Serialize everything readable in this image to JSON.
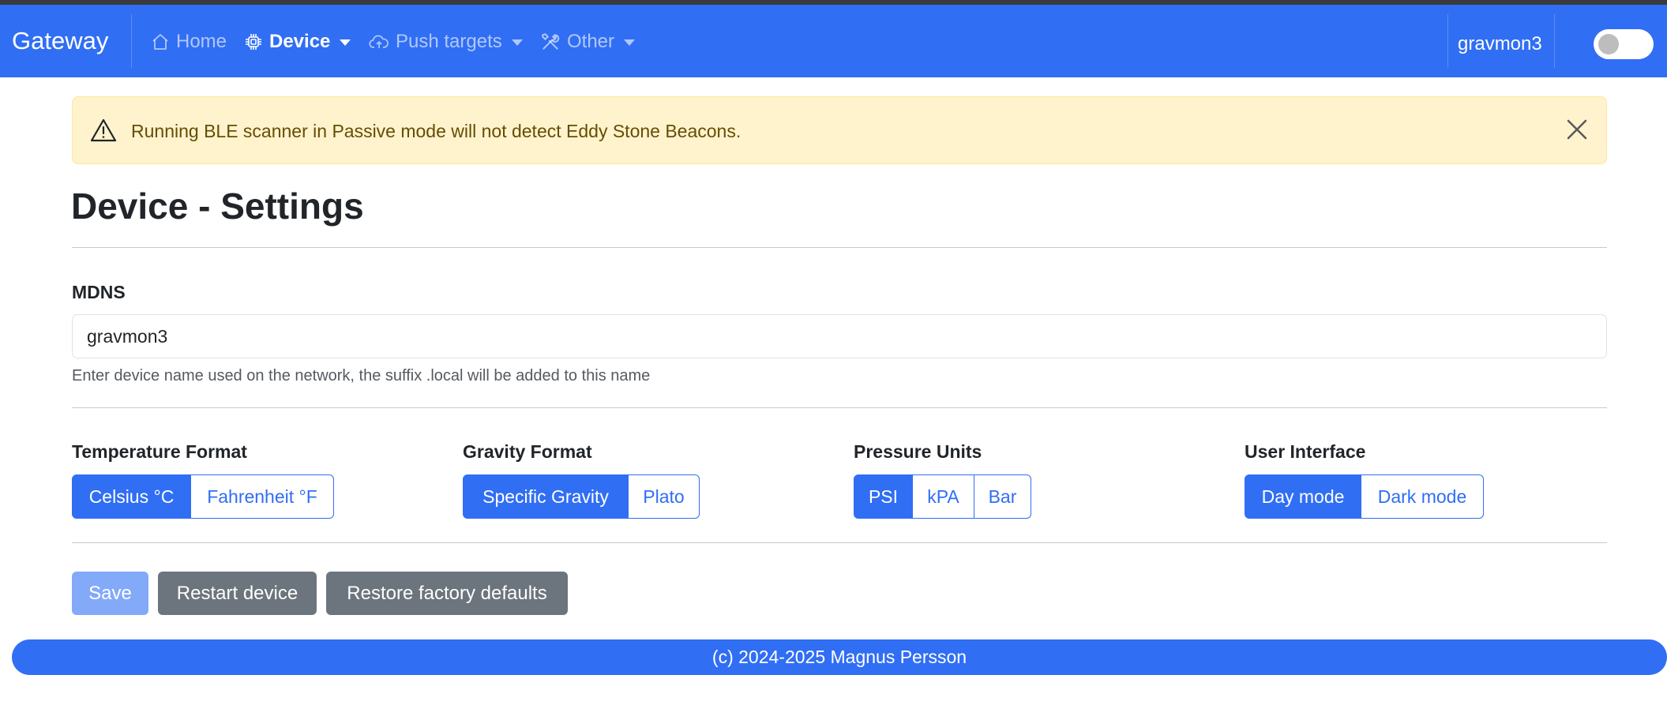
{
  "colors": {
    "primary": "#306ef4",
    "warning_bg": "#fff3cd",
    "warning_text": "#664d03",
    "secondary": "#6c757d"
  },
  "navbar": {
    "brand": "Gateway",
    "items": [
      {
        "label": "Home",
        "icon": "house-icon",
        "active": false
      },
      {
        "label": "Device",
        "icon": "cpu-icon",
        "active": true,
        "dropdown": true
      },
      {
        "label": "Push targets",
        "icon": "cloud-upload-icon",
        "active": false,
        "dropdown": true
      },
      {
        "label": "Other",
        "icon": "tools-icon",
        "active": false,
        "dropdown": true
      }
    ],
    "hostname": "gravmon3",
    "theme_toggle_on": false
  },
  "alert": {
    "message": "Running BLE scanner in Passive mode will not detect Eddy Stone Beacons.",
    "icon": "warning-triangle-icon"
  },
  "page": {
    "title": "Device - Settings"
  },
  "mdns": {
    "label": "MDNS",
    "value": "gravmon3",
    "help": "Enter device name used on the network, the suffix .local will be added to this name"
  },
  "formats": {
    "temperature": {
      "label": "Temperature Format",
      "options": [
        "Celsius °C",
        "Fahrenheit °F"
      ],
      "selected": "Celsius °C"
    },
    "gravity": {
      "label": "Gravity Format",
      "options": [
        "Specific Gravity",
        "Plato"
      ],
      "selected": "Specific Gravity"
    },
    "pressure": {
      "label": "Pressure Units",
      "options": [
        "PSI",
        "kPA",
        "Bar"
      ],
      "selected": "PSI"
    },
    "ui": {
      "label": "User Interface",
      "options": [
        "Day mode",
        "Dark mode"
      ],
      "selected": "Day mode"
    }
  },
  "actions": {
    "save": "Save",
    "restart": "Restart device",
    "restore": "Restore factory defaults"
  },
  "footer": {
    "text": "(c) 2024-2025 Magnus Persson"
  }
}
